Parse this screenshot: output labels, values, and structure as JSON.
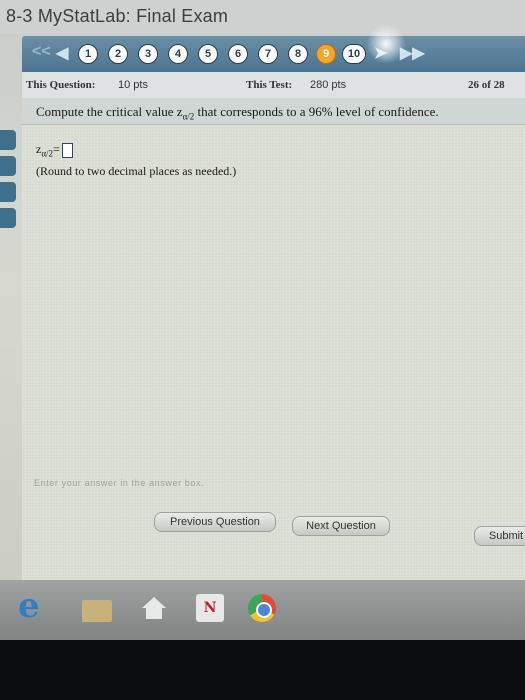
{
  "window": {
    "title": "8-3 MyStatLab: Final Exam"
  },
  "nav": {
    "first_label": "<<",
    "prev_label": "◀",
    "next_label": "➤",
    "last_label": "▶▶",
    "questions": [
      "1",
      "2",
      "3",
      "4",
      "5",
      "6",
      "7",
      "8",
      "9",
      "10"
    ],
    "current": "9"
  },
  "info": {
    "this_question_label": "This Question:",
    "this_question_value": "10 pts",
    "this_test_label": "This Test:",
    "this_test_value": "280 pts",
    "progress": "26 of 28"
  },
  "question": {
    "prefix": "Compute the critical value z",
    "subscript": "α/2",
    "suffix": " that corresponds to a 96% level of confidence.",
    "answer_label": "z",
    "answer_sub": "α/2",
    "answer_eq": "=",
    "answer_value": "",
    "instruction": "(Round to two decimal places as needed.)"
  },
  "status": {
    "text": "Enter your answer in the answer box."
  },
  "buttons": {
    "previous": "Previous Question",
    "next": "Next Question",
    "submit": "Submit"
  },
  "taskbar": {
    "n_label": "N"
  }
}
